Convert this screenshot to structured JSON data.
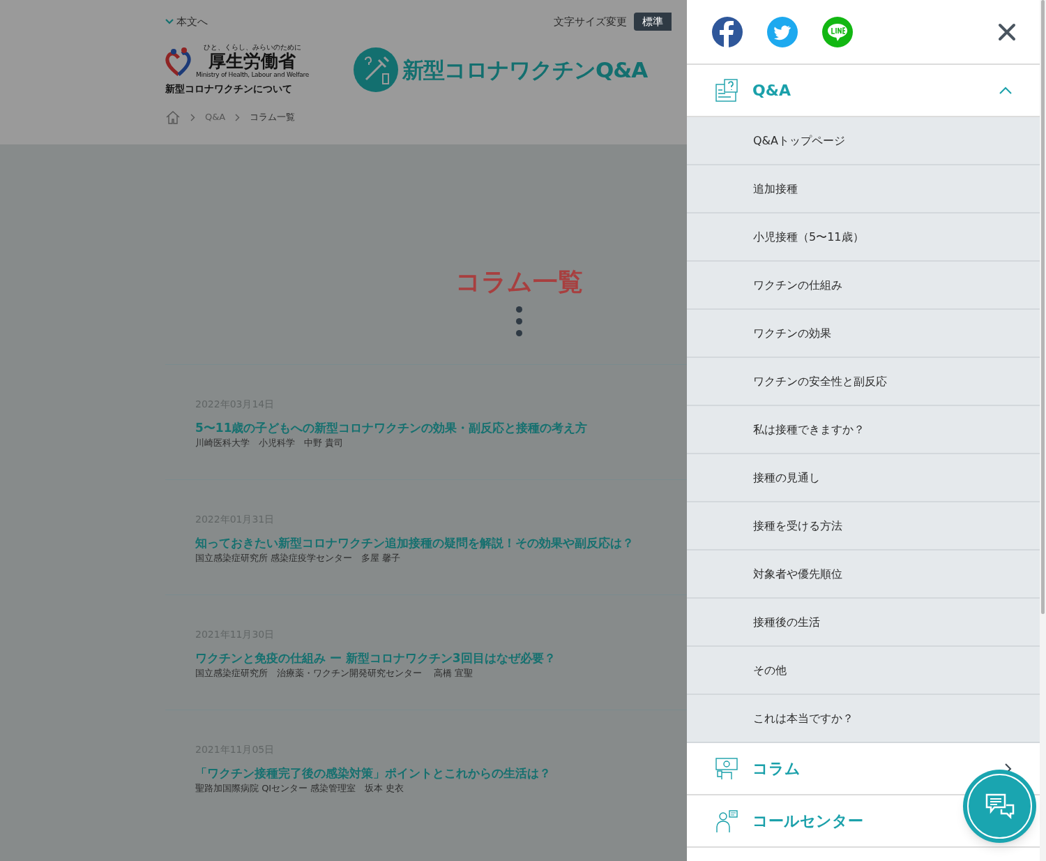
{
  "header": {
    "skip_link": "本文へ",
    "font_size_label": "文字サイズ変更",
    "font_size_options": [
      {
        "label": "標準",
        "selected": true
      }
    ],
    "logo": {
      "tagline": "ひと、くらし、みらいのために",
      "name": "厚生労働省",
      "english": "Ministry of Health, Labour and Welfare",
      "subtitle": "新型コロナワクチンについて"
    },
    "site_title": "新型コロナワクチンQ&A"
  },
  "breadcrumbs": [
    "Q&A",
    "コラム一覧"
  ],
  "page_title": "コラム一覧",
  "articles": [
    {
      "date": "2022年03月14日",
      "title": "5〜11歳の子どもへの新型コロナワクチンの効果・副反応と接種の考え方",
      "author": "川崎医科大学　小児科学　中野 貴司"
    },
    {
      "date": "2022年01月31日",
      "title": "知っておきたい新型コロナワクチン追加接種の疑問を解説！その効果や副反応は？",
      "author": "国立感染症研究所 感染症疫学センター　多屋 馨子"
    },
    {
      "date": "2021年11月30日",
      "title": "ワクチンと免疫の仕組み ー 新型コロナワクチン3回目はなぜ必要？",
      "author": "国立感染症研究所　治療薬・ワクチン開発研究センター　 高橋 宜聖"
    },
    {
      "date": "2021年11月05日",
      "title": "「ワクチン接種完了後の感染対策」ポイントとこれからの生活は？",
      "author": "聖路加国際病院 QIセンター 感染管理室　坂本 史衣"
    }
  ],
  "drawer": {
    "sections": [
      {
        "kind": "accordion",
        "label": "Q&A",
        "expanded": true,
        "children": [
          "Q&Aトップページ",
          "追加接種",
          "小児接種（5〜11歳）",
          "ワクチンの仕組み",
          "ワクチンの効果",
          "ワクチンの安全性と副反応",
          "私は接種できますか？",
          "接種の見通し",
          "接種を受ける方法",
          "対象者や優先順位",
          "接種後の生活",
          "その他",
          "これは本当ですか？"
        ]
      },
      {
        "kind": "link",
        "label": "コラム"
      },
      {
        "kind": "link",
        "label": "コールセンター"
      }
    ]
  }
}
